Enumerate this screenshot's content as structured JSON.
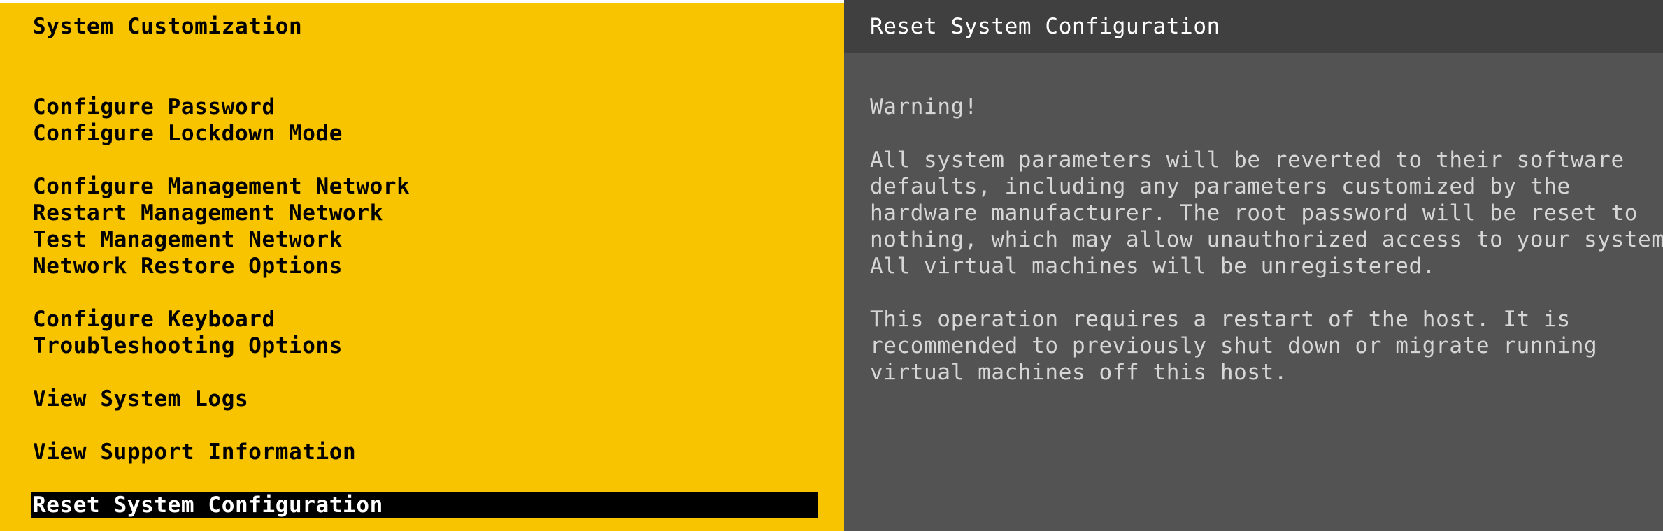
{
  "left_pane": {
    "title": "System Customization",
    "menu": [
      {
        "label": "Configure Password",
        "selected": false
      },
      {
        "label": "Configure Lockdown Mode",
        "selected": false
      },
      {
        "label": "Configure Management Network",
        "selected": false
      },
      {
        "label": "Restart Management Network",
        "selected": false
      },
      {
        "label": "Test Management Network",
        "selected": false
      },
      {
        "label": "Network Restore Options",
        "selected": false
      },
      {
        "label": "Configure Keyboard",
        "selected": false
      },
      {
        "label": "Troubleshooting Options",
        "selected": false
      },
      {
        "label": "View System Logs",
        "selected": false
      },
      {
        "label": "View Support Information",
        "selected": false
      },
      {
        "label": "Reset System Configuration",
        "selected": true
      }
    ]
  },
  "right_pane": {
    "title": "Reset System Configuration",
    "warning_heading": "Warning!",
    "paragraph1": [
      "All system parameters will be reverted to their software",
      "defaults, including any parameters customized by the",
      "hardware manufacturer. The root password will be reset to",
      "nothing, which may allow unauthorized access to your system.",
      "All virtual machines will be unregistered."
    ],
    "paragraph2": [
      "This operation requires a restart of the host. It is",
      "recommended to previously shut down or migrate running",
      "virtual machines off this host."
    ]
  },
  "colors": {
    "left_background": "#F8C400",
    "right_background": "#535353",
    "selected_background": "#000000",
    "selected_text": "#FFFFFF",
    "detail_text": "#D6D6D6"
  }
}
